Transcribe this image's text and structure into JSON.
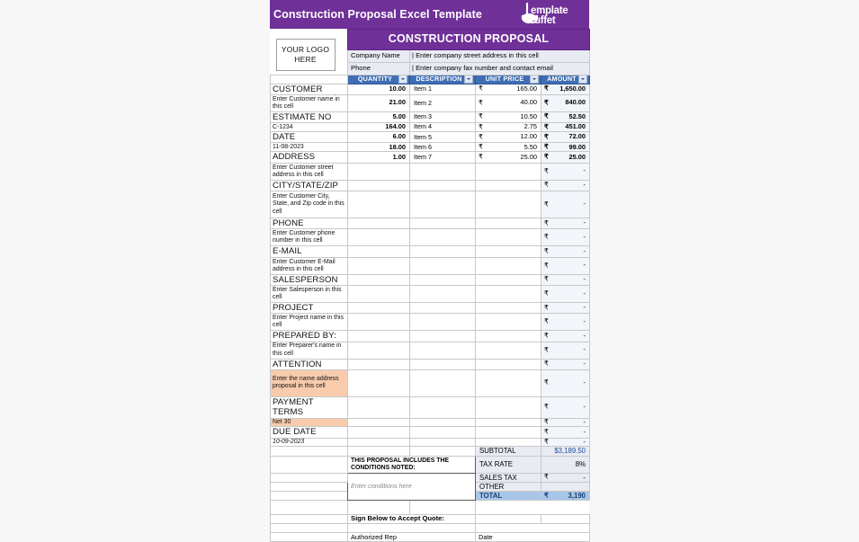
{
  "banner": {
    "title": "Construction Proposal Excel Template",
    "logo_name": "template-buffet-logo",
    "logo_line1": "emplate",
    "logo_line2": "uffet",
    "bg_color": "#6f3098"
  },
  "logo_placeholder": {
    "line1": "YOUR LOGO",
    "line2": "HERE"
  },
  "header": {
    "proposal_title": "CONSTRUCTION PROPOSAL",
    "company_name_label": "Company Name",
    "company_name_value": "| Enter company street address in this cell",
    "phone_label": "Phone",
    "phone_value": "| Enter company fax number and contact email"
  },
  "columns": [
    {
      "label": "QUANTITY"
    },
    {
      "label": "DESCRIPTION"
    },
    {
      "label": "UNIT PRICE"
    },
    {
      "label": "AMOUNT"
    }
  ],
  "currency_symbol": "₹",
  "customer_info": [
    {
      "heading": "CUSTOMER",
      "value": "Enter Customer name in this cell",
      "italic": false,
      "highlight": false
    },
    {
      "heading": "ESTIMATE NO",
      "value": "C-1234",
      "italic": false,
      "highlight": false
    },
    {
      "heading": "DATE",
      "value": "11-08-2023",
      "italic": false,
      "highlight": false
    },
    {
      "heading": "ADDRESS",
      "value": "Enter Customer street address in this cell",
      "italic": false,
      "highlight": false
    },
    {
      "heading": "CITY/STATE/ZIP",
      "value": "Enter Customer City, State, and Zip code in this cell",
      "italic": false,
      "highlight": false
    },
    {
      "heading": "PHONE",
      "value": "Enter Customer phone number in this cell",
      "italic": false,
      "highlight": false
    },
    {
      "heading": "E-MAIL",
      "value": "Enter Customer E-Mail address in this cell",
      "italic": false,
      "highlight": false
    },
    {
      "heading": "SALESPERSON",
      "value": "Enter Salesperson in this cell",
      "italic": false,
      "highlight": false
    },
    {
      "heading": "PROJECT",
      "value": "Enter Project name in this cell",
      "italic": false,
      "highlight": false
    },
    {
      "heading": "PREPARED BY:",
      "value": "Enter Preparer's name in this cell",
      "italic": false,
      "highlight": false
    },
    {
      "heading": "ATTENTION",
      "value": "Enter the name address proposal in this cell",
      "italic": false,
      "highlight": true
    },
    {
      "heading": "PAYMENT TERMS",
      "value": "Net 30",
      "italic": false,
      "highlight": true
    },
    {
      "heading": "DUE DATE",
      "value": "10-09-2023",
      "italic": true,
      "highlight": false
    }
  ],
  "line_items": [
    {
      "quantity": "10.00",
      "description": "Item 1",
      "unit_price": "165.00",
      "amount": "1,650.00"
    },
    {
      "quantity": "21.00",
      "description": "Item 2",
      "unit_price": "40.00",
      "amount": "840.00"
    },
    {
      "quantity": "5.00",
      "description": "Item 3",
      "unit_price": "10.50",
      "amount": "52.50"
    },
    {
      "quantity": "164.00",
      "description": "Item 4",
      "unit_price": "2.75",
      "amount": "451.00"
    },
    {
      "quantity": "6.00",
      "description": "Item 5",
      "unit_price": "12.00",
      "amount": "72.00"
    },
    {
      "quantity": "18.00",
      "description": "Item 6",
      "unit_price": "5.50",
      "amount": "99.00"
    },
    {
      "quantity": "1.00",
      "description": "Item 7",
      "unit_price": "25.00",
      "amount": "25.00"
    }
  ],
  "empty_amount": "-",
  "totals": {
    "subtotal_label": "SUBTOTAL",
    "subtotal_value": "$3,189.50",
    "tax_rate_label": "TAX RATE",
    "tax_rate_value": "8%",
    "sales_tax_label": "SALES TAX",
    "sales_tax_value": "-",
    "other_label": "OTHER",
    "other_value": "",
    "total_label": "TOTAL",
    "total_value": "3,190"
  },
  "conditions": {
    "heading": "THIS PROPOSAL INCLUDES THE CONDITIONS NOTED:",
    "placeholder": "Enter conditions here"
  },
  "signature": {
    "prompt": "Sign Below to Accept Quote:",
    "rep_label": "Authorized Rep",
    "date_label": "Date"
  }
}
